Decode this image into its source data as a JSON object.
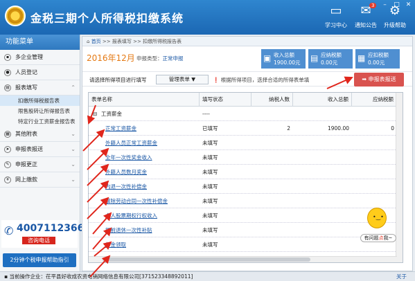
{
  "header": {
    "app_title": "金税三期个人所得税扣缴系统",
    "buttons": [
      {
        "label": "学习中心",
        "icon": "monitor-icon"
      },
      {
        "label": "通知公告",
        "icon": "mail-icon",
        "badge": "3"
      },
      {
        "label": "升级帮助",
        "icon": "gear-icon"
      }
    ]
  },
  "sidebar": {
    "title": "功能菜单",
    "items": [
      {
        "label": "多企业管理"
      },
      {
        "label": "人员登记"
      },
      {
        "label": "报表填写"
      },
      {
        "label": "扣缴所得税报告表"
      },
      {
        "label": "限售股转让所得报告表"
      },
      {
        "label": "特定行业工资薪金报告表"
      },
      {
        "label": "其他附表"
      },
      {
        "label": "申报表报送"
      },
      {
        "label": "申报更正"
      },
      {
        "label": "网上缴款"
      }
    ],
    "hotline": {
      "number": "4007112366",
      "sub": "咨询电话"
    },
    "promo": "2分钟个税申报帮助指引"
  },
  "breadcrumb": {
    "home": "首页",
    "path": ">> 报表填写 >> 扣缴所得税报告表"
  },
  "period": {
    "date": "2016年12月",
    "type_label": "申报类型：",
    "type_value": "正常申报"
  },
  "stats": [
    {
      "label": "收入总额",
      "value": "1900.00元"
    },
    {
      "label": "应纳税额",
      "value": "0.00元"
    },
    {
      "label": "应扣税额",
      "value": "0.00元"
    }
  ],
  "toolbar": {
    "hint1": "请选择所得项目进行填写",
    "select": "管理表单 ▼",
    "hint2": "根据所得项目，选择合适的所得表单填",
    "submit": "申报表报送"
  },
  "table": {
    "columns": [
      "表单名称",
      "填写状态",
      "纳税人数",
      "收入总额",
      "应纳税额"
    ],
    "group": "工资薪金",
    "group_status": "----",
    "rows": [
      {
        "name": "正常工资薪金",
        "status": "已填写",
        "count": "2",
        "income": "1900.00",
        "tax": "0"
      },
      {
        "name": "外籍人员正常工资薪金",
        "status": "未填写",
        "count": "",
        "income": "",
        "tax": ""
      },
      {
        "name": "全年一次性奖金收入",
        "status": "未填写",
        "count": "",
        "income": "",
        "tax": ""
      },
      {
        "name": "外籍人员数月奖金",
        "status": "未填写",
        "count": "",
        "income": "",
        "tax": ""
      },
      {
        "name": "内退一次性补偿金",
        "status": "未填写",
        "count": "",
        "income": "",
        "tax": ""
      },
      {
        "name": "解除劳动合同一次性补偿金",
        "status": "未填写",
        "count": "",
        "income": "",
        "tax": ""
      },
      {
        "name": "个人股票期权行权收入",
        "status": "未填写",
        "count": "",
        "income": "",
        "tax": ""
      },
      {
        "name": "提前退休一次性补贴",
        "status": "未填写",
        "count": "",
        "income": "",
        "tax": ""
      },
      {
        "name": "年金领取",
        "status": "未填写",
        "count": "",
        "income": "",
        "tax": ""
      }
    ]
  },
  "mascot": {
    "bubble_pre": "有问题",
    "bubble_hi": "点",
    "bubble_post": "我~"
  },
  "footer": {
    "label": "当前操作企业：",
    "company": "茌平县好收成农资电销网络信息有限公司[371523348892011]",
    "close": "关于"
  }
}
